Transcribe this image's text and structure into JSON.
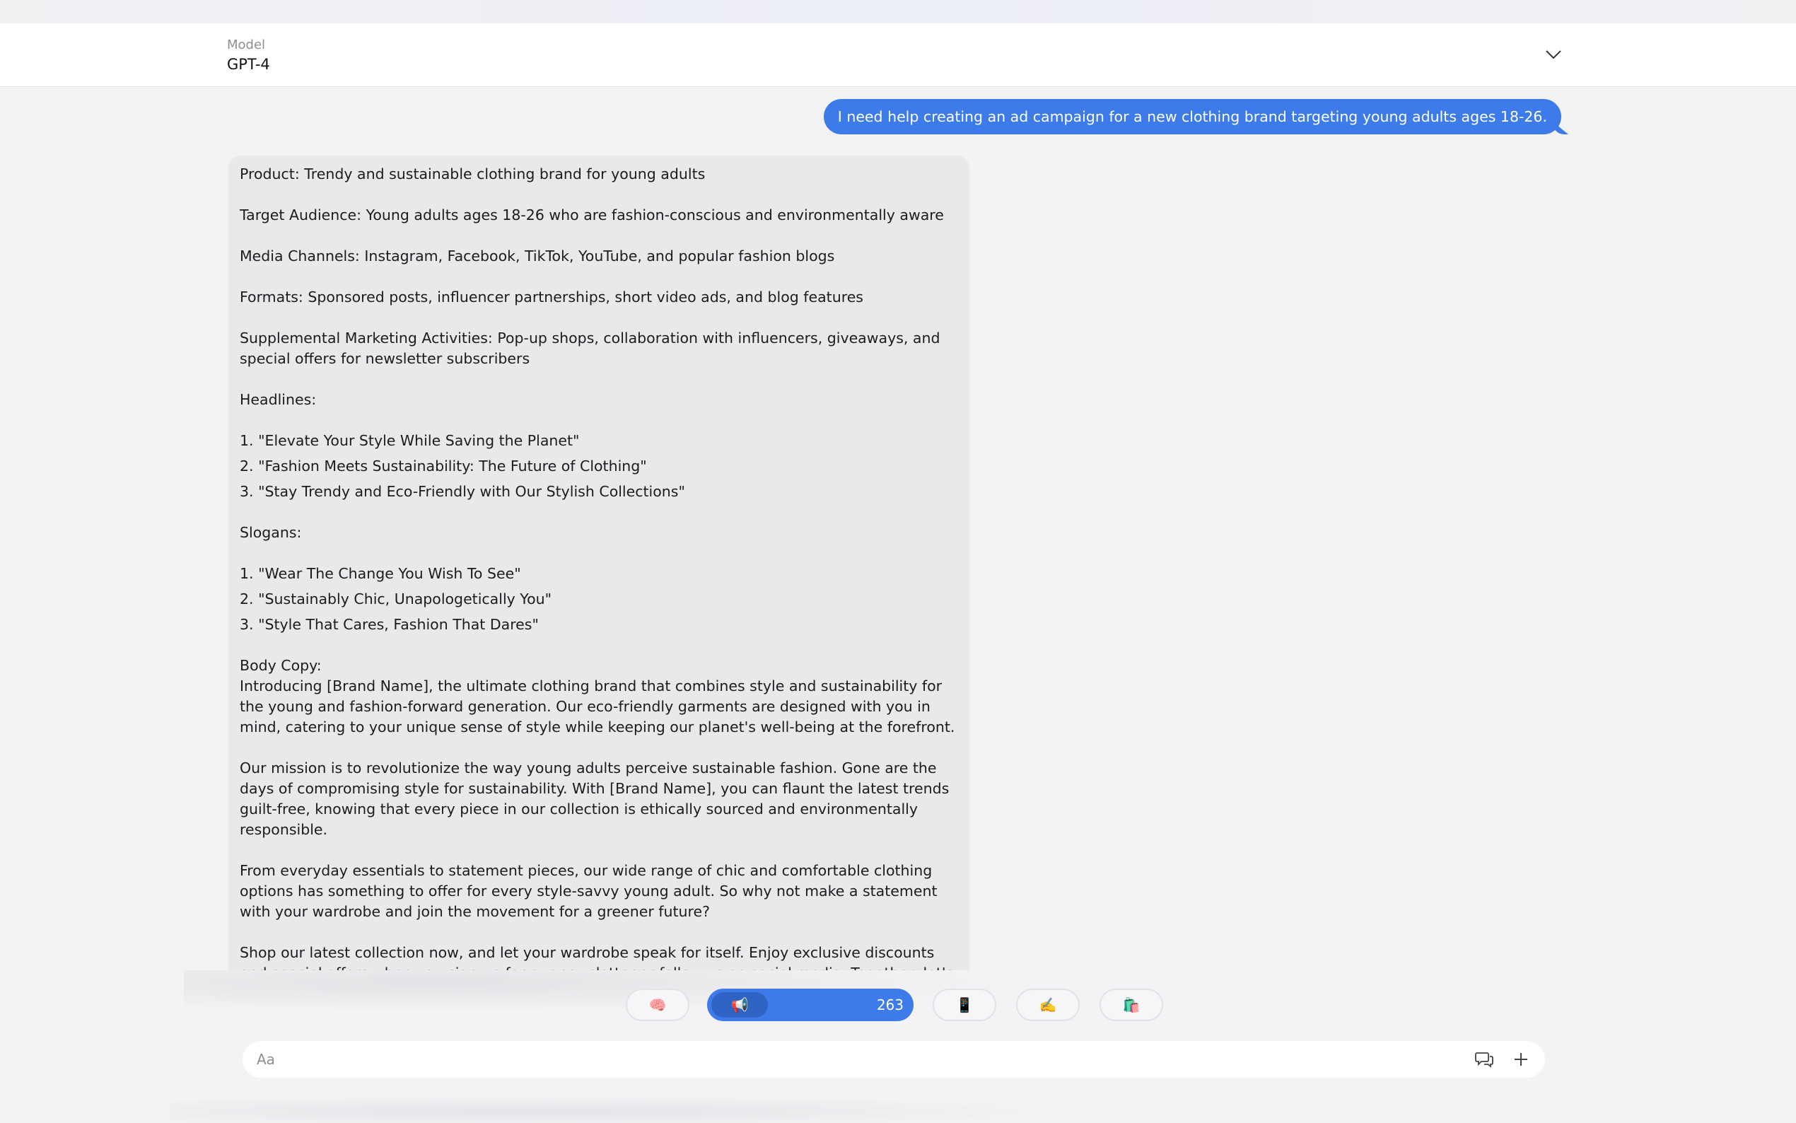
{
  "header": {
    "model_label": "Model",
    "model_value": "GPT-4"
  },
  "conversation": {
    "user_message": "I need help creating an ad campaign for a new clothing brand targeting young adults ages 18-26.",
    "assistant": {
      "product": "Product: Trendy and sustainable clothing brand for young adults",
      "target_audience": "Target Audience: Young adults ages 18-26 who are fashion-conscious and environmentally aware",
      "media_channels": "Media Channels: Instagram, Facebook, TikTok, YouTube, and popular fashion blogs",
      "formats": "Formats: Sponsored posts, influencer partnerships, short video ads, and blog features",
      "supplemental": "Supplemental Marketing Activities: Pop-up shops, collaboration with influencers, giveaways, and special offers for newsletter subscribers",
      "headlines_title": "Headlines:",
      "headlines": [
        "1.  \"Elevate Your Style While Saving the Planet\"",
        "2.  \"Fashion Meets Sustainability: The Future of Clothing\"",
        "3.  \"Stay Trendy and Eco-Friendly with Our Stylish Collections\""
      ],
      "slogans_title": "Slogans:",
      "slogans": [
        "1.  \"Wear The Change You Wish To See\"",
        "2.  \"Sustainably Chic, Unapologetically You\"",
        "3.  \"Style That Cares, Fashion That Dares\""
      ],
      "body_copy_title": "Body Copy:",
      "body_paragraphs": [
        "Introducing [Brand Name], the ultimate clothing brand that combines style and sustainability for the young and fashion-forward generation. Our eco-friendly garments are designed with you in mind, catering to your unique sense of style while keeping our planet's well-being at the forefront.",
        "Our mission is to revolutionize the way young adults perceive sustainable fashion. Gone are the days of compromising style for sustainability. With [Brand Name], you can flaunt the latest trends guilt-free, knowing that every piece in our collection is ethically sourced and environmentally responsible.",
        "From everyday essentials to statement pieces, our wide range of chic and comfortable clothing options has something to offer for every style-savvy young adult. So why not make a statement with your wardrobe and join the movement for a greener future?",
        "Shop our latest collection now, and let your wardrobe speak for itself. Enjoy exclusive discounts and special offers when you sign up for our newsletter or follow us on social media. Together, let's take a stand for a more sustainable future, one stylish outfit at a time."
      ]
    }
  },
  "suggestions": {
    "chip1_emoji": "🧠",
    "active_emoji": "📢",
    "active_count": "263",
    "chip3_emoji": "📱",
    "chip4_emoji": "✍️",
    "chip5_emoji": "🛍️"
  },
  "composer": {
    "placeholder": "Aa"
  },
  "colors": {
    "accent": "#3d7bea",
    "bubble_gray": "#e9e9ec",
    "background": "#f3f3f5"
  }
}
